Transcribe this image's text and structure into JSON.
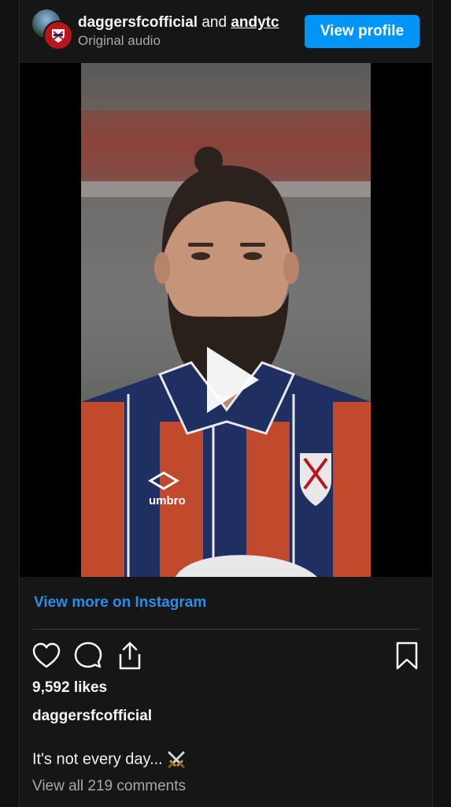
{
  "header": {
    "account_name": "daggersfcofficial",
    "connector": "and",
    "collaborator": "andytc",
    "subtitle": "Original audio",
    "view_profile_label": "View profile"
  },
  "video": {
    "state": "paused",
    "jersey_brand": "umbro"
  },
  "footer": {
    "view_more_label": "View more on Instagram",
    "likes_text": "9,592 likes",
    "caption_username": "daggersfcofficial",
    "caption_text": "It's not every day...",
    "caption_emoji": "crossed-swords-icon",
    "comments_text": "View all 219 comments"
  },
  "icons": [
    "like-heart-icon",
    "comment-icon",
    "share-icon",
    "save-bookmark-icon",
    "play-icon"
  ],
  "colors": {
    "accent_button": "#0095f6",
    "link_blue": "#2e8ce6",
    "background": "#161616",
    "muted_text": "#a8a8a8"
  }
}
